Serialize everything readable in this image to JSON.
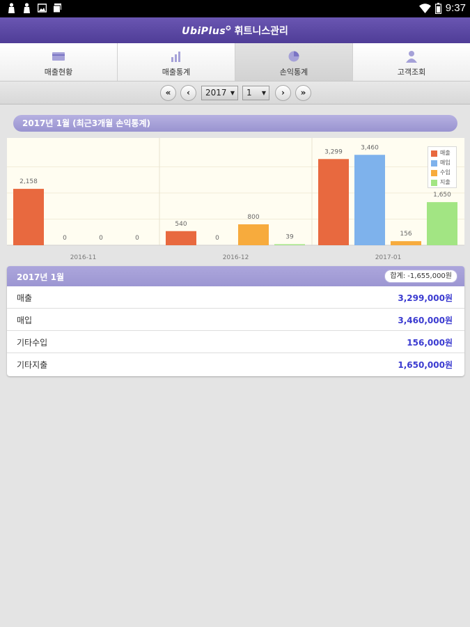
{
  "status_bar": {
    "time": "9:37",
    "icons": [
      "notification-icon",
      "notification-icon",
      "image-icon",
      "photo-icon",
      "wifi-icon",
      "battery-icon"
    ]
  },
  "app": {
    "brand": "UbiPlus",
    "title": "휘트니스관리"
  },
  "tabs": [
    {
      "label": "매출현황",
      "icon": "card-icon",
      "active": false
    },
    {
      "label": "매출통계",
      "icon": "bar-chart-icon",
      "active": false
    },
    {
      "label": "손익통계",
      "icon": "pie-chart-icon",
      "active": true
    },
    {
      "label": "고객조회",
      "icon": "person-icon",
      "active": false
    }
  ],
  "period_nav": {
    "year": "2017",
    "month": "1"
  },
  "section_title": "2017년 1월 (최근3개월 손익통계)",
  "chart_data": {
    "type": "bar",
    "categories": [
      "2016-11",
      "2016-12",
      "2017-01"
    ],
    "series": [
      {
        "name": "매출",
        "color": "#e8693f",
        "values": [
          2158,
          540,
          3299
        ]
      },
      {
        "name": "매입",
        "color": "#7eb2ec",
        "values": [
          0,
          0,
          3460
        ]
      },
      {
        "name": "수입",
        "color": "#f7ab3d",
        "values": [
          0,
          800,
          156
        ]
      },
      {
        "name": "지출",
        "color": "#a2e583",
        "values": [
          0,
          39,
          1650
        ]
      }
    ],
    "data_labels": [
      [
        "2,158",
        "0",
        "0",
        "0"
      ],
      [
        "540",
        "0",
        "800",
        "39"
      ],
      [
        "3,299",
        "3,460",
        "156",
        "1,650"
      ]
    ],
    "ylim": [
      0,
      4000
    ],
    "legend_position": "top-right"
  },
  "summary": {
    "title": "2017년 1월",
    "total": "합계: -1,655,000원",
    "rows": [
      {
        "label": "매출",
        "value": "3,299,000원"
      },
      {
        "label": "매입",
        "value": "3,460,000원"
      },
      {
        "label": "기타수입",
        "value": "156,000원"
      },
      {
        "label": "기타지출",
        "value": "1,650,000원"
      }
    ]
  }
}
